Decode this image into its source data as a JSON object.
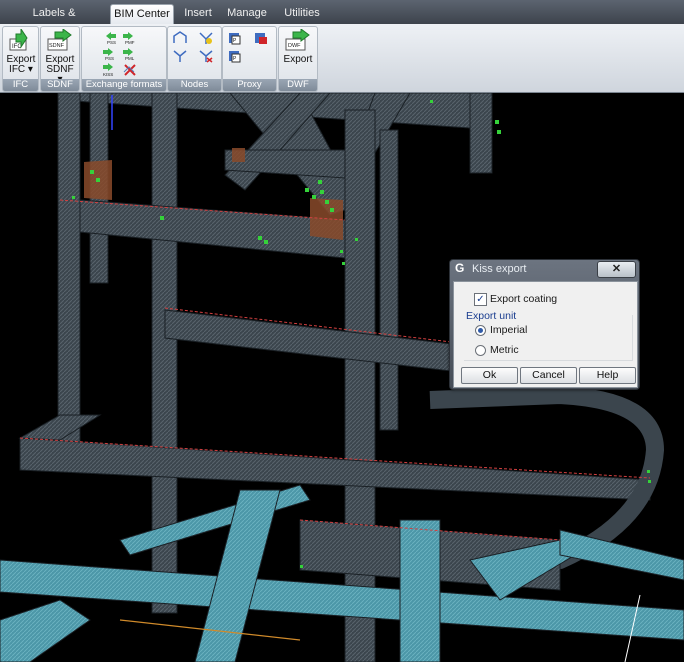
{
  "tabs": [
    {
      "label": "Labels & Dimensions"
    },
    {
      "label": "BIM Center"
    },
    {
      "label": "Insert"
    },
    {
      "label": "Manage"
    },
    {
      "label": "Utilities"
    }
  ],
  "ribbon": {
    "ifc": {
      "icon_text": "IFC",
      "label1": "Export",
      "label2": "IFC ▾",
      "panel": "IFC"
    },
    "sdnf": {
      "icon_text": "SDNF",
      "label1": "Export",
      "label2": "SDNF ▾",
      "panel": "SDNF"
    },
    "exchange": {
      "panel": "Exchange formats",
      "icons": [
        "PSS",
        "PMF",
        "PSS",
        "PML",
        "KISS"
      ]
    },
    "nodes": {
      "panel": "Nodes"
    },
    "proxy": {
      "panel": "Proxy"
    },
    "dwf": {
      "icon_text": "DWF",
      "label1": "Export",
      "panel": "DWF"
    }
  },
  "dialog": {
    "logo": "G",
    "title": "Kiss export",
    "close": "✕",
    "export_coating": {
      "label": "Export coating",
      "checked": true
    },
    "export_unit": {
      "legend": "Export unit",
      "options": [
        {
          "label": "Imperial",
          "selected": true
        },
        {
          "label": "Metric",
          "selected": false
        }
      ]
    },
    "buttons": {
      "ok": "Ok",
      "cancel": "Cancel",
      "help": "Help"
    }
  },
  "colors": {
    "accent": "#2f5aa8",
    "ribbon_title_bar": "#8895a4",
    "beam_teal": "#4c97a8",
    "beam_dark": "#3b454d",
    "weld_green": "#35d23a",
    "plate_brown": "#8a4a2a"
  }
}
